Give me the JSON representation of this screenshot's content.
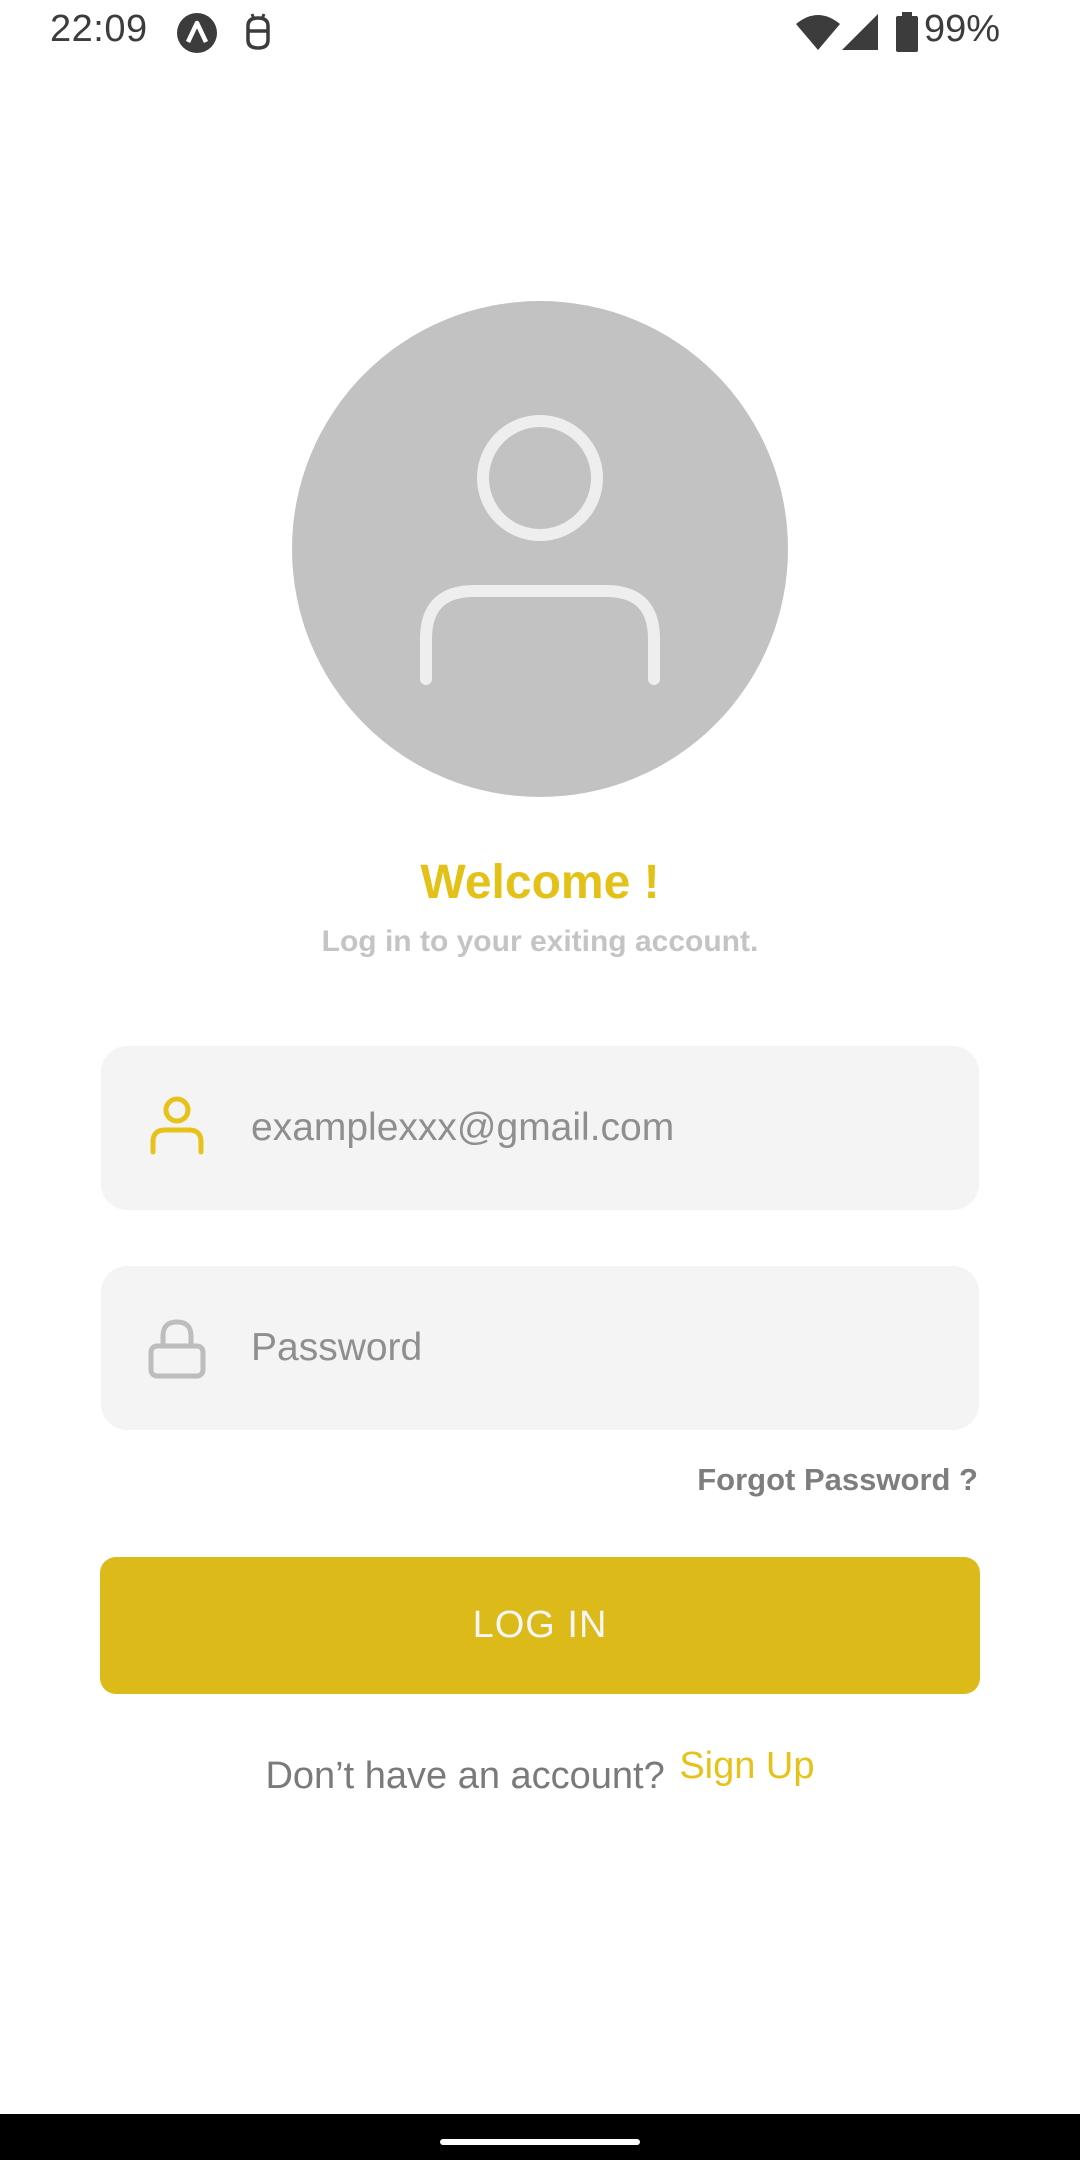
{
  "status_bar": {
    "time": "22:09",
    "battery_percent": "99%",
    "icons": [
      "app-a-icon",
      "android-debug-icon",
      "wifi-icon",
      "signal-icon",
      "battery-icon"
    ]
  },
  "avatar": {
    "icon": "user-placeholder-icon",
    "background_color": "#c2c2c2"
  },
  "welcome": {
    "title": "Welcome !",
    "subtitle": "Log in to your exiting account."
  },
  "form": {
    "email": {
      "icon": "user-icon",
      "placeholder": "examplexxx@gmail.com",
      "value": ""
    },
    "password": {
      "icon": "lock-icon",
      "placeholder": "Password",
      "value": ""
    },
    "forgot_password_label": "Forgot Password ?",
    "login_label": "LOG IN"
  },
  "signup": {
    "prompt": "Don’t have an account?",
    "link_label": "Sign Up"
  },
  "colors": {
    "accent": "#e3c117",
    "button": "#dbba1a",
    "field_background": "#f4f4f4"
  }
}
